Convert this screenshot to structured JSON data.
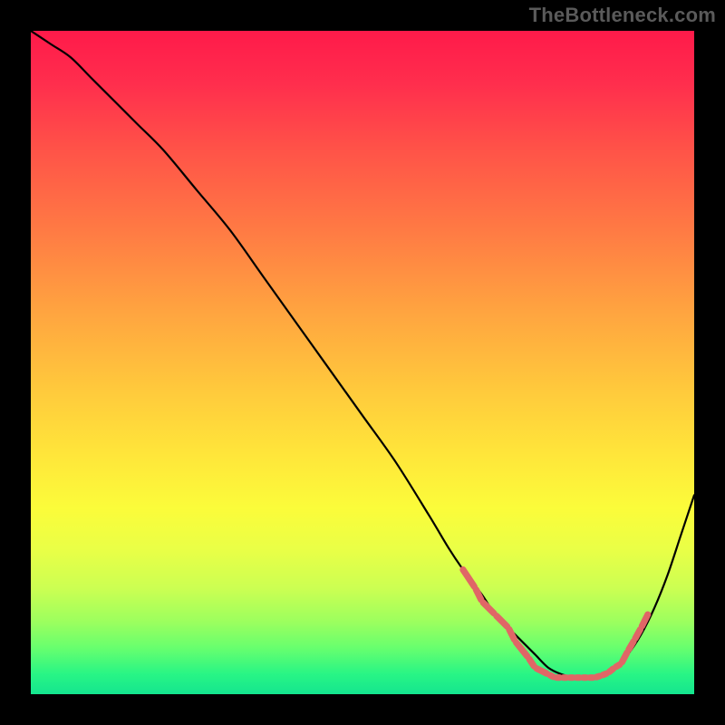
{
  "watermark": "TheBottleneck.com",
  "chart_data": {
    "type": "line",
    "title": "",
    "xlabel": "",
    "ylabel": "",
    "xlim": [
      0,
      100
    ],
    "ylim": [
      0,
      100
    ],
    "grid": false,
    "legend": false,
    "series": [
      {
        "name": "bottleneck-curve",
        "x": [
          0,
          3,
          6,
          9,
          12,
          16,
          20,
          25,
          30,
          35,
          40,
          45,
          50,
          55,
          60,
          63,
          65,
          68,
          70,
          72,
          74,
          76,
          78,
          80,
          82,
          84,
          86,
          88,
          90,
          92,
          94,
          96,
          98,
          100
        ],
        "y": [
          100,
          98,
          96,
          93,
          90,
          86,
          82,
          76,
          70,
          63,
          56,
          49,
          42,
          35,
          27,
          22,
          19,
          15,
          12,
          10,
          8,
          6,
          4,
          3,
          2.5,
          2.5,
          3,
          4,
          6,
          9,
          13,
          18,
          24,
          30
        ]
      }
    ],
    "markers": {
      "name": "highlight-dots",
      "color": "#e06666",
      "points": [
        {
          "x": 65,
          "y": 19
        },
        {
          "x": 67,
          "y": 16
        },
        {
          "x": 68,
          "y": 14
        },
        {
          "x": 70,
          "y": 12
        },
        {
          "x": 72,
          "y": 10
        },
        {
          "x": 73,
          "y": 8
        },
        {
          "x": 75,
          "y": 5.5
        },
        {
          "x": 76,
          "y": 4
        },
        {
          "x": 78,
          "y": 3
        },
        {
          "x": 79,
          "y": 2.5
        },
        {
          "x": 80,
          "y": 2.5
        },
        {
          "x": 81,
          "y": 2.5
        },
        {
          "x": 82,
          "y": 2.5
        },
        {
          "x": 83,
          "y": 2.5
        },
        {
          "x": 84,
          "y": 2.5
        },
        {
          "x": 85,
          "y": 2.5
        },
        {
          "x": 86,
          "y": 2.8
        },
        {
          "x": 87,
          "y": 3.2
        },
        {
          "x": 88,
          "y": 4
        },
        {
          "x": 89,
          "y": 4.6
        },
        {
          "x": 90,
          "y": 6.5
        },
        {
          "x": 91,
          "y": 8.2
        },
        {
          "x": 92,
          "y": 10
        },
        {
          "x": 93,
          "y": 12
        }
      ]
    }
  }
}
